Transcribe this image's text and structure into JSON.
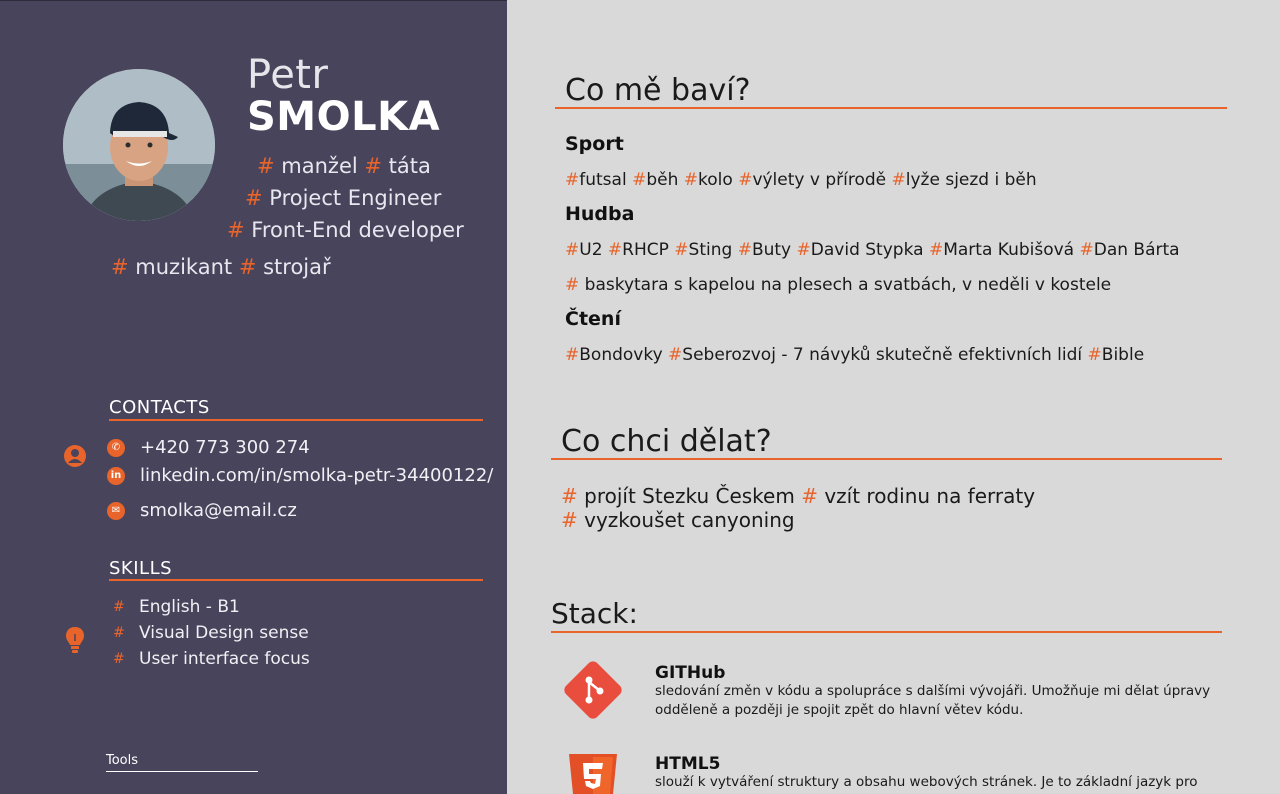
{
  "profile": {
    "first_name": "Petr",
    "last_name": "SMOLKA",
    "avatar_icon": "person-photo",
    "tags_line1": [
      " manžel",
      " táta"
    ],
    "tags_line2": " Project Engineer",
    "tags_line3": " Front-End developer",
    "tags_line4": [
      " muzikant",
      " strojař"
    ]
  },
  "contacts": {
    "title": "CONTACTS",
    "phone": "+420 773 300 274",
    "linkedin": "linkedin.com/in/smolka-petr-34400122/",
    "email": "smolka@email.cz"
  },
  "skills": {
    "title": "SKILLS",
    "items": [
      "English - B1",
      "Visual Design sense",
      "User interface focus"
    ]
  },
  "tools": {
    "title": "Tools"
  },
  "hobbies": {
    "title": "Co mě baví?",
    "sport_title": "Sport",
    "sport_tags": [
      "futsal ",
      "běh ",
      "kolo ",
      "výlety v přírodě ",
      "lyže sjezd i běh"
    ],
    "music_title": "Hudba",
    "music_tags": [
      "U2 ",
      "RHCP ",
      "Sting ",
      "Buty ",
      "David Stypka ",
      "Marta Kubišová ",
      "Dan Bárta"
    ],
    "music_extra": " baskytara s kapelou na plesech a svatbách, v neděli v kostele",
    "reading_title": "Čtení",
    "reading_tags": [
      "Bondovky ",
      "Seberozvoj - 7 návyků skutečně efektivních lidí ",
      "Bible"
    ]
  },
  "plans": {
    "title": "Co chci dělat?",
    "line1": [
      " projít Stezku Českem ",
      " vzít rodinu na ferraty"
    ],
    "line2": " vyzkoušet canyoning"
  },
  "stack": {
    "title": "Stack:",
    "items": [
      {
        "name": "GITHub",
        "desc": "sledování změn v kódu a spolupráce s dalšími vývojáři. Umožňuje mi dělat úpravy odděleně a později je spojit zpět do hlavní větev kódu."
      },
      {
        "name": "HTML5",
        "desc": "slouží k vytváření struktury a obsahu webových stránek. Je to základní jazyk pro"
      }
    ]
  },
  "colors": {
    "accent": "#e8642b",
    "sidebar": "#48445c",
    "content_bg": "#d9d9d9"
  }
}
